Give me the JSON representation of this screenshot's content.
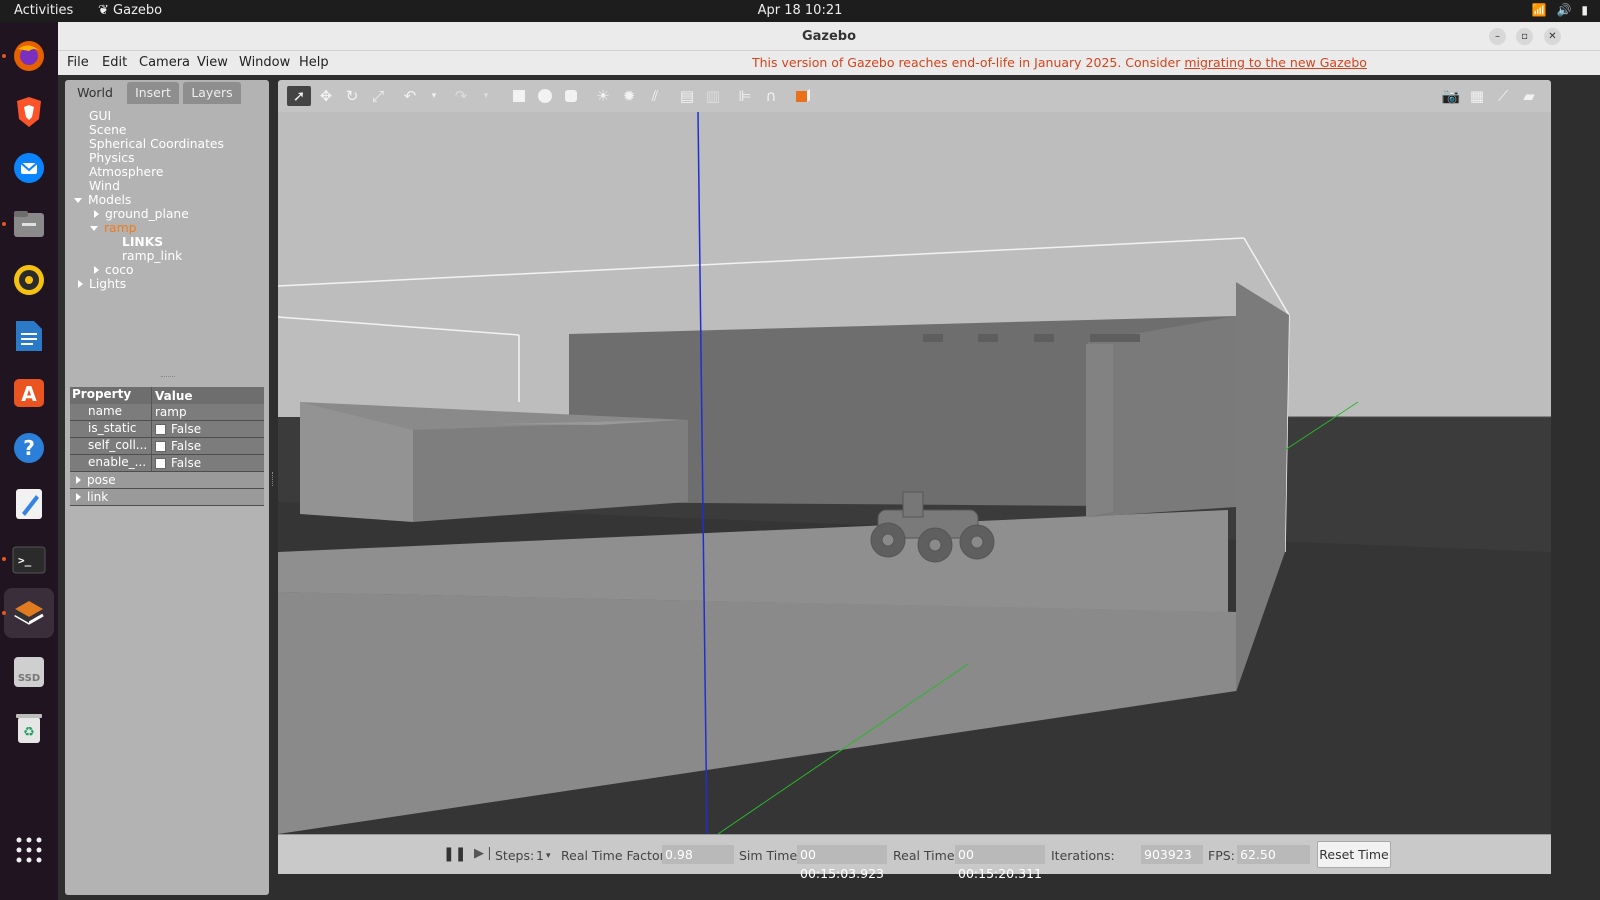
{
  "topbar": {
    "activities": "Activities",
    "app_name": "Gazebo",
    "clock": "Apr 18  10:21"
  },
  "dock": [
    {
      "name": "firefox-icon",
      "color": "#e66000"
    },
    {
      "name": "brave-icon",
      "color": "#fb542b"
    },
    {
      "name": "thunderbird-icon",
      "color": "#0a84ff"
    },
    {
      "name": "files-icon",
      "color": "#7c7c7c"
    },
    {
      "name": "rhythmbox-icon",
      "color": "#f5c211"
    },
    {
      "name": "writer-icon",
      "color": "#2a7ac8"
    },
    {
      "name": "software-icon",
      "color": "#e95420"
    },
    {
      "name": "help-icon",
      "color": "#2c7fd8"
    },
    {
      "name": "text-editor-icon",
      "color": "#3584e4"
    },
    {
      "name": "terminal-icon",
      "color": "#333333"
    },
    {
      "name": "gazebo-icon",
      "color": "#e07b20"
    },
    {
      "name": "ssd-icon",
      "color": "#cccccc",
      "label": "SSD"
    },
    {
      "name": "trash-icon",
      "color": "#dddddd"
    }
  ],
  "window": {
    "title": "Gazebo",
    "menus": [
      "File",
      "Edit",
      "Camera",
      "View",
      "Window",
      "Help"
    ],
    "eol_text": "This version of Gazebo reaches end-of-life in January 2025. Consider ",
    "eol_link": "migrating to the new Gazebo"
  },
  "tabs": [
    "World",
    "Insert",
    "Layers"
  ],
  "tree": {
    "gui": "GUI",
    "scene": "Scene",
    "spherical": "Spherical Coordinates",
    "physics": "Physics",
    "atmosphere": "Atmosphere",
    "wind": "Wind",
    "models": "Models",
    "ground_plane": "ground_plane",
    "ramp": "ramp",
    "links": "LINKS",
    "ramp_link": "ramp_link",
    "coco": "coco",
    "lights": "Lights"
  },
  "props": {
    "header_property": "Property",
    "header_value": "Value",
    "rows": [
      {
        "name": "name",
        "value": "ramp"
      },
      {
        "name": "is_static",
        "value": "False"
      },
      {
        "name": "self_coll...",
        "value": "False"
      },
      {
        "name": "enable_...",
        "value": "False"
      }
    ],
    "pose": "pose",
    "link": "link"
  },
  "bottom": {
    "steps_label": "Steps:",
    "steps_value": "1",
    "rtf_label": "Real Time Factor:",
    "rtf_value": "0.98",
    "sim_label": "Sim Time:",
    "sim_value": "00 00:15:03.923",
    "real_label": "Real Time:",
    "real_value": "00 00:15:20.311",
    "iter_label": "Iterations:",
    "iter_value": "903923",
    "fps_label": "FPS:",
    "fps_value": "62.50",
    "reset": "Reset Time"
  },
  "colors": {
    "selected": "#f07a1a",
    "eol": "#d4441c",
    "z_axis": "#1f2fd0",
    "y_axis": "#2cb52c"
  }
}
